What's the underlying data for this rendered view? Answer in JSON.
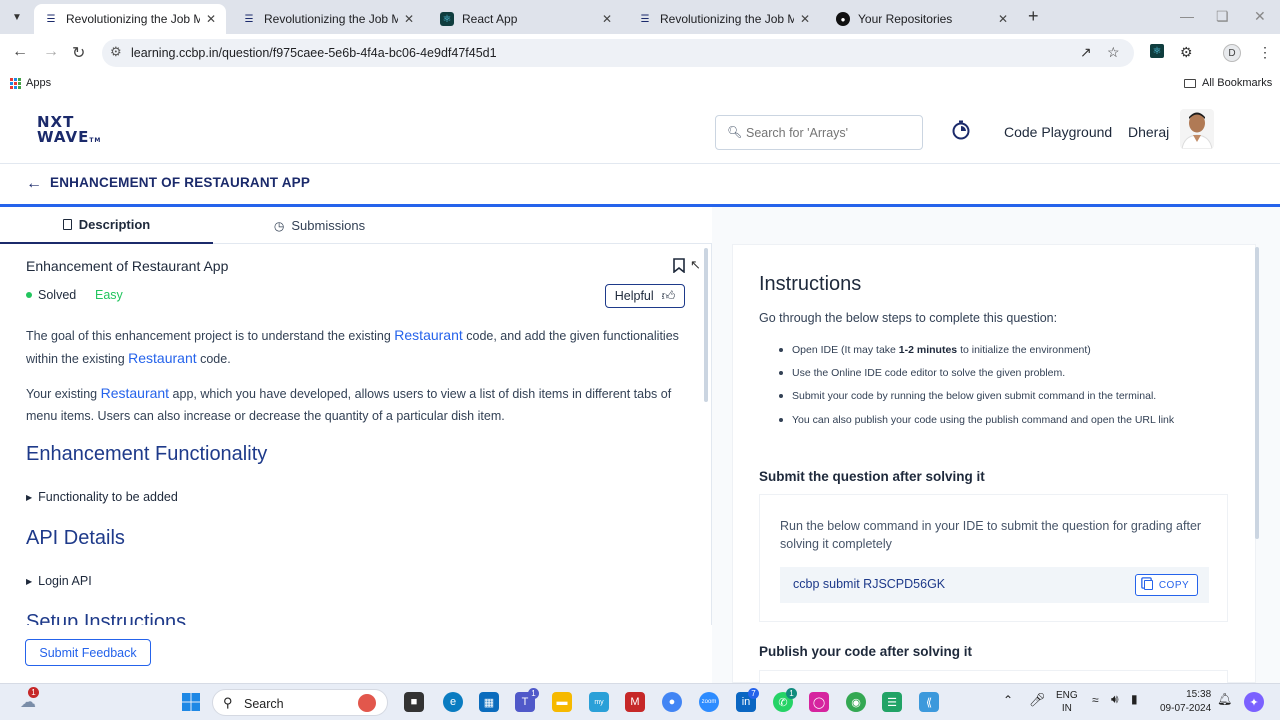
{
  "browser": {
    "tabs": [
      {
        "title": "Revolutionizing the Job Market",
        "active": true
      },
      {
        "title": "Revolutionizing the Job Market",
        "active": false
      },
      {
        "title": "React App",
        "active": false
      },
      {
        "title": "Revolutionizing the Job Market",
        "active": false
      },
      {
        "title": "Your Repositories",
        "active": false
      }
    ],
    "url": "learning.ccbp.in/question/f975caee-5e6b-4f4a-bc06-4e9df47f45d1",
    "profile_initial": "D",
    "bookmarks": {
      "apps": "Apps",
      "all": "All Bookmarks"
    }
  },
  "header": {
    "logo_line1": "NXT",
    "logo_line2": "WAVE",
    "logo_tm": "TM",
    "search_placeholder": "Search for 'Arrays'",
    "code_playground": "Code Playground",
    "user_name": "Dheraj"
  },
  "page": {
    "title": "ENHANCEMENT OF RESTAURANT APP",
    "tabs": [
      "Description",
      "Submissions"
    ]
  },
  "question": {
    "title": "Enhancement of Restaurant App",
    "status": "Solved",
    "difficulty": "Easy",
    "helpful": "Helpful",
    "para1": {
      "a": "The goal of this enhancement project is to understand the existing ",
      "hl1": "Restaurant",
      "b": " code, and add the given functionalities within the existing ",
      "hl2": "Restaurant",
      "c": " code."
    },
    "para2": {
      "a": "Your existing ",
      "hl": "Restaurant",
      "b": " app, which you have developed, allows users to view a list of dish items in different tabs of menu items. Users can also increase or decrease the quantity of a particular dish item."
    },
    "section1": "Enhancement Functionality",
    "section1_item": "Functionality to be added",
    "section2": "API Details",
    "section2_item": "Login API",
    "section3": "Setup Instructions",
    "feedback_button": "Submit Feedback"
  },
  "instructions": {
    "title": "Instructions",
    "lead": "Go through the below steps to complete this question:",
    "steps": [
      {
        "pre": "Open IDE (It may take ",
        "bold": "1-2 minutes",
        "post": " to initialize the environment)"
      },
      {
        "pre": "Use the Online IDE code editor to solve the given problem.",
        "bold": "",
        "post": ""
      },
      {
        "pre": "Submit your code by running the below given submit command in the terminal.",
        "bold": "",
        "post": ""
      },
      {
        "pre": "You can also publish your code using the publish command and open the URL link",
        "bold": "",
        "post": ""
      }
    ],
    "submit_heading": "Submit the question after solving it",
    "submit_text": "Run the below command in your IDE to submit the question for grading after solving it completely",
    "submit_command": "ccbp submit RJSCPD56GK",
    "copy_label": "COPY",
    "publish_heading": "Publish your code after solving it"
  },
  "taskbar": {
    "search": "Search",
    "weather_badge": "1",
    "teams_badge": "1",
    "linkedin_badge": "7",
    "whatsapp_badge": "1",
    "lang": "ENG",
    "region": "IN",
    "time": "15:38",
    "date": "09-07-2024"
  }
}
